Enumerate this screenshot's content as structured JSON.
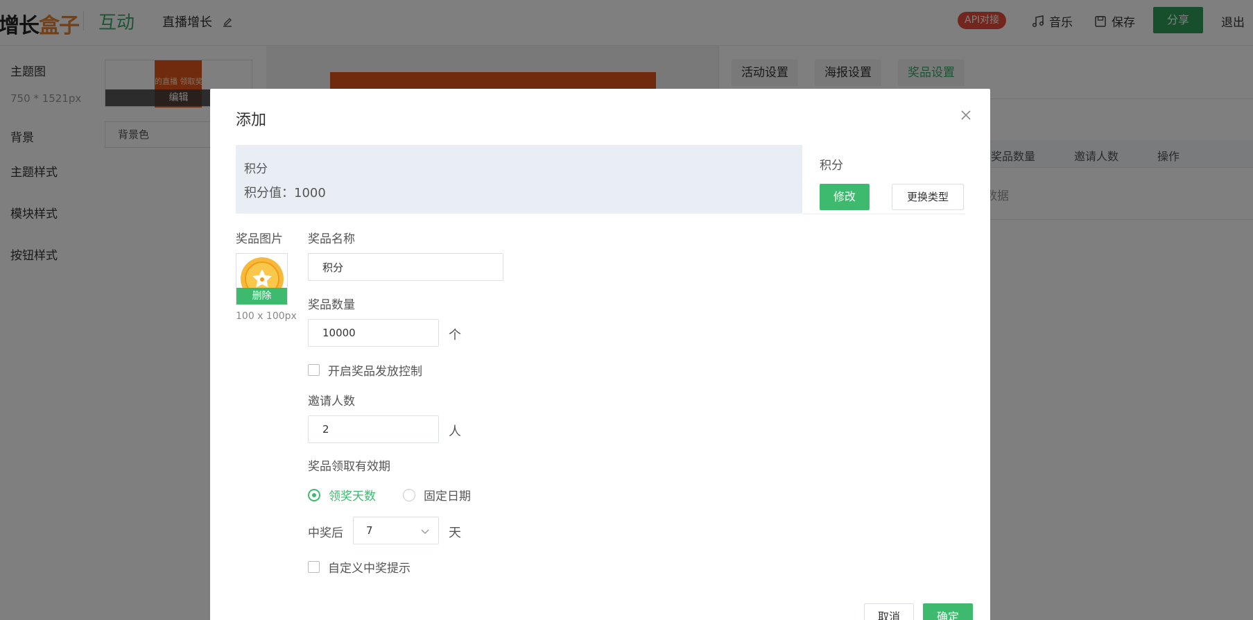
{
  "topbar": {
    "logo_main": "增长",
    "logo_accent": "盒子",
    "app_name": "互动",
    "activity_title": "直播增长",
    "api_badge": "API对接",
    "music": "音乐",
    "save": "保存",
    "share": "分享",
    "logout": "退出"
  },
  "left_panel": {
    "theme_image_label": "主题图",
    "theme_image_size": "750 * 1521px",
    "theme_thumb_text": "的直播 领取奖",
    "theme_edit": "编辑",
    "background_label": "背景",
    "background_value": "背景色",
    "theme_style_label": "主题样式",
    "module_style_label": "模块样式",
    "button_style_label": "按钮样式"
  },
  "right_panel": {
    "tabs": [
      {
        "label": "活动设置"
      },
      {
        "label": "海报设置"
      },
      {
        "label": "奖品设置"
      }
    ],
    "columns": [
      "奖品数量",
      "邀请人数",
      "操作"
    ],
    "empty_text": "数据"
  },
  "modal": {
    "title": "添加",
    "prize_card": {
      "type": "积分",
      "value_line": "积分值：1000"
    },
    "side_title": "积分",
    "modify": "修改",
    "change_type": "更换类型",
    "image_label": "奖品图片",
    "image_delete": "删除",
    "image_size": "100 x 100px",
    "name_label": "奖品名称",
    "name_value": "积分",
    "quantity_label": "奖品数量",
    "quantity_value": "10000",
    "quantity_unit": "个",
    "control_label": "开启奖品发放控制",
    "invite_label": "邀请人数",
    "invite_value": "2",
    "invite_unit": "人",
    "validity_label": "奖品领取有效期",
    "radio_days": "领奖天数",
    "radio_date": "固定日期",
    "after_label": "中奖后",
    "days_value": "7",
    "days_unit": "天",
    "custom_tip_label": "自定义中奖提示",
    "cancel": "取消",
    "ok": "确定"
  },
  "colors": {
    "brand_green": "#3dba6e",
    "accent_orange": "#e8812f",
    "api_red": "#e74c3c"
  }
}
